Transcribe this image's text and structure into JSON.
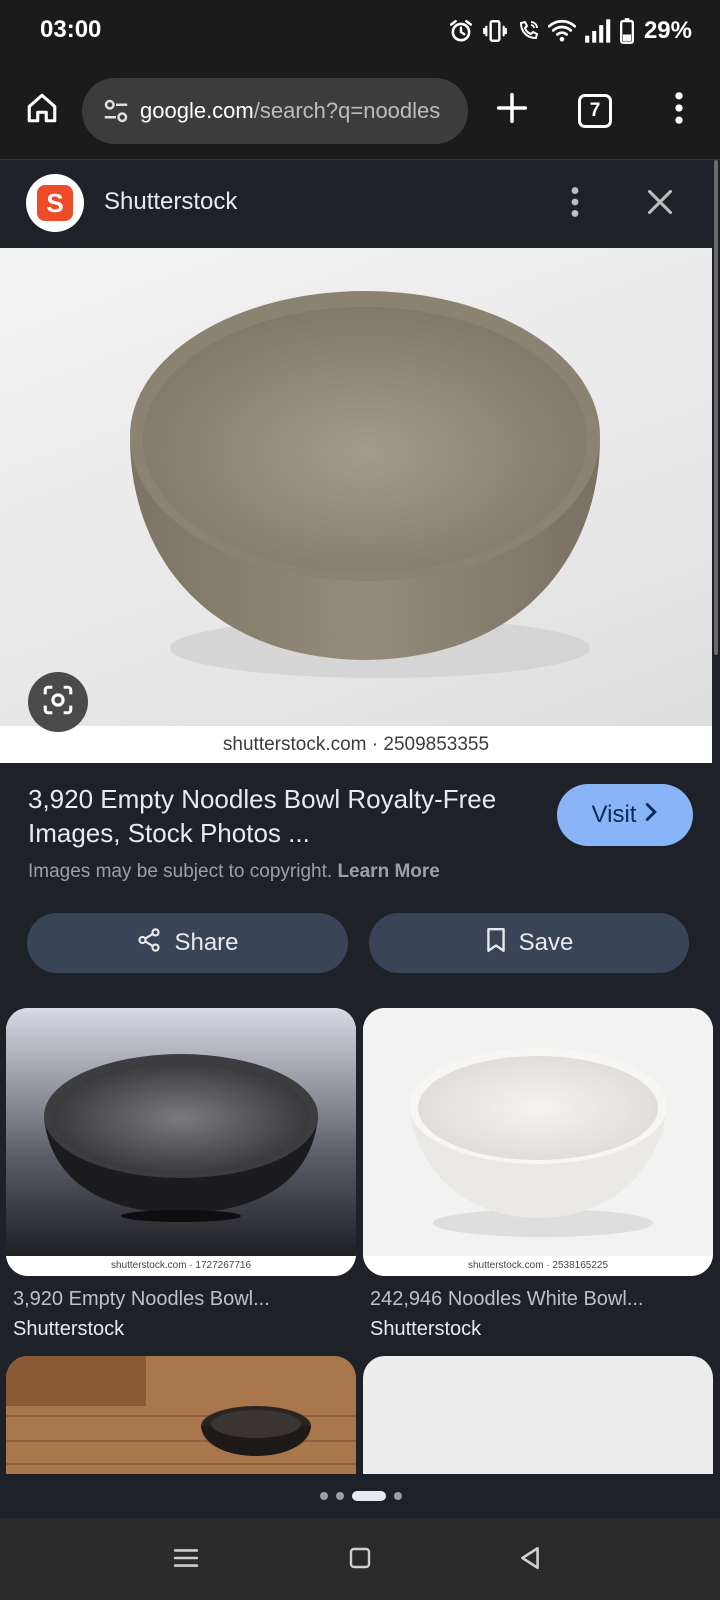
{
  "status_bar": {
    "time": "03:00",
    "battery_percent": "29%",
    "icons": [
      "alarm-icon",
      "vibrate-icon",
      "wifi-calling-icon",
      "wifi-icon",
      "signal-icon",
      "battery-icon"
    ]
  },
  "browser": {
    "url_host": "google.com",
    "url_path": "/search?q=noodles",
    "tab_count": "7"
  },
  "source": {
    "name": "Shutterstock",
    "logo_letter": "S",
    "logo_color": "#ee4b2b"
  },
  "preview": {
    "caption": "shutterstock.com · 2509853355"
  },
  "result": {
    "title": "3,920 Empty Noodles Bowl Royalty-Free Images, Stock Photos ...",
    "visit_label": "Visit",
    "copyright_text": "Images may be subject to copyright.",
    "learn_more": "Learn More"
  },
  "actions": {
    "share_label": "Share",
    "save_label": "Save"
  },
  "related": [
    {
      "caption": "shutterstock.com · 1727267716",
      "title": "3,920 Empty Noodles Bowl...",
      "source": "Shutterstock"
    },
    {
      "caption": "shutterstock.com · 2538165225",
      "title": "242,946 Noodles White Bowl...",
      "source": "Shutterstock"
    }
  ],
  "colors": {
    "accent_button": "#8ab4f8",
    "action_button": "#394457",
    "background": "#1f2128"
  }
}
